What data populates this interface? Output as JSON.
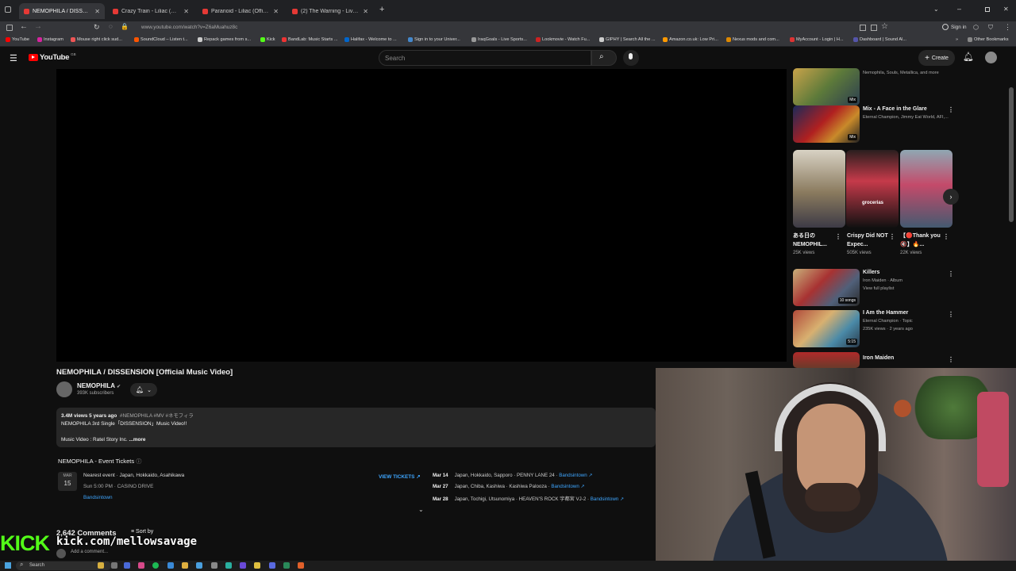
{
  "browser": {
    "tabs": [
      {
        "label": "NEMOPHILA / DISSENSION [Off",
        "active": true
      },
      {
        "label": "Crazy Train - Liliac (Official Cove",
        "active": false
      },
      {
        "label": "Paranoid - Liliac (Official Cover",
        "active": false
      },
      {
        "label": "(2) The Warning - Live from Pep",
        "active": false
      }
    ],
    "url": "www.youtube.com/watch?v=Z6aMuahuz8c",
    "sign_in": "Sign in",
    "bookmarks": [
      "YouTube",
      "Instagram",
      "Mouse right click sud...",
      "SoundCloud – Listen t...",
      "Repack games from s...",
      "Kick",
      "BandLab: Music Starts ...",
      "Halifax - Welcome to ...",
      "Sign in to your Univer...",
      "IraqGoals - Live Sports...",
      "Lookmovie - Watch Fu...",
      "GIPHY | Search All the ...",
      "Amazon.co.uk: Low Pri...",
      "Nexus mods and com...",
      "MyAccount - Login | H...",
      "Dashboard | Sound Al..."
    ],
    "other_bookmarks": "Other Bookmarks"
  },
  "youtube": {
    "logo": "YouTube",
    "country": "GB",
    "search_placeholder": "Search",
    "create_label": "Create"
  },
  "video": {
    "title": "NEMOPHILA / DISSENSION [Official Music Video]",
    "channel": "NEMOPHILA",
    "subscribers": "393K subscribers",
    "stats": "3.4M views  5 years ago",
    "tags": "#NEMOPHILA #MV #ネモフィラ",
    "desc_line1": "NEMOPHILA 3rd Single「DISSENSION」Music Video!!",
    "desc_line2": "Music Video : Ratel Story Inc.",
    "more": "...more"
  },
  "events": {
    "title": "NEMOPHILA - Event Tickets",
    "date_month": "MAR",
    "date_day": "15",
    "nearest": "Nearest event · Japan, Hokkaido, Asahikawa",
    "time_venue": "Sun 5:00 PM · CASINO DRIVE",
    "provider": "Bandsintown",
    "view_tickets": "VIEW TICKETS ↗",
    "list": [
      {
        "date": "Mar 14",
        "text": "Japan, Hokkaido, Sapporo · PENNY LANE 24 ·",
        "link": "Bandsintown ↗"
      },
      {
        "date": "Mar 27",
        "text": "Japan, Chiba, Kashiwa · Kashiwa Palooza ·",
        "link": "Bandsintown ↗"
      },
      {
        "date": "Mar 28",
        "text": "Japan, Tochigi, Utsunomiya · HEAVEN'S ROCK 宇都宮 VJ-2 ·",
        "link": "Bandsintown ↗"
      }
    ]
  },
  "comments": {
    "count": "2,642 Comments",
    "sort": "Sort by",
    "add": "Add a comment..."
  },
  "sidebar": {
    "items": [
      {
        "title": "",
        "sub": "Nemophila, Souls, Metallica, and more",
        "badge": "Mix"
      },
      {
        "title": "Mix - A Face in the Glare",
        "sub": "Eternal Champion, Jimmy Eat World, AFI,...",
        "badge": "Mix"
      },
      {
        "title": "Killers",
        "sub": "Iron Maiden · Album",
        "sub2": "View full playlist",
        "badge": "10 songs"
      },
      {
        "title": "I Am the Hammer",
        "sub": "Eternal Champion · Topic",
        "sub2": "235K views · 2 years ago",
        "badge": "5:15"
      },
      {
        "title": "Iron Maiden",
        "sub": "Iron Maiden",
        "badge": ""
      }
    ],
    "shorts": [
      {
        "title": "ある日の NEMOPHIL...",
        "views": "25K views"
      },
      {
        "title": "Crispy Did NOT Expec...",
        "views": "505K views"
      },
      {
        "title": "【🔴Thank you 🔇】🔥...",
        "views": "22K views"
      }
    ],
    "short_overlay_text": "grocerias"
  },
  "stream_overlay": {
    "kick_logo": "KICK",
    "kick_url": "kick.com/mellowsavage"
  },
  "taskbar": {
    "search": "Search"
  },
  "colors": {
    "background": "#0f0f0f",
    "kick_green": "#53fc18",
    "link_blue": "#3ea6ff",
    "youtube_red": "#ff0000"
  }
}
